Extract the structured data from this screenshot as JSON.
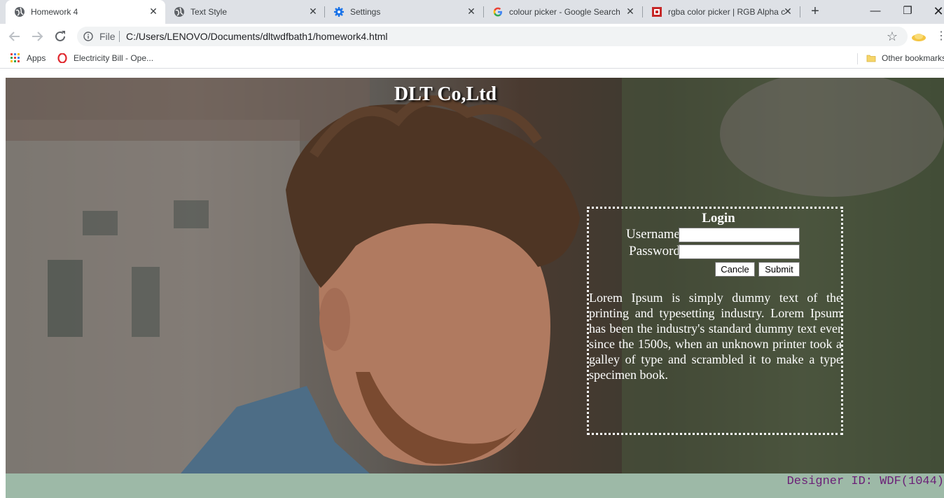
{
  "browser": {
    "tabs": [
      {
        "title": "Homework 4",
        "icon": "globe-icon",
        "active": true
      },
      {
        "title": "Text Style",
        "icon": "globe-icon",
        "active": false
      },
      {
        "title": "Settings",
        "icon": "gear-icon",
        "active": false
      },
      {
        "title": "colour picker - Google Search",
        "icon": "google-icon",
        "active": false
      },
      {
        "title": "rgba color picker | RGB Alpha c",
        "icon": "site-icon",
        "active": false
      }
    ],
    "address": {
      "scheme_label": "File",
      "url": "C:/Users/LENOVO/Documents/dltwdfbath1/homework4.html"
    },
    "bookmarks": {
      "apps_label": "Apps",
      "items": [
        {
          "label": "Electricity Bill - Ope...",
          "icon": "opera-icon"
        }
      ],
      "other_label": "Other bookmarks"
    }
  },
  "page": {
    "title": "DLT Co,Ltd",
    "login": {
      "heading": "Login",
      "username_label": "Username",
      "password_label": "Password",
      "cancel_label": "Cancle",
      "submit_label": "Submit"
    },
    "lorem": "Lorem Ipsum is simply dummy text of the printing and typesetting industry. Lorem Ipsum has been the industry's standard dummy text ever since the 1500s, when an unknown printer took a galley of type and scrambled it to make a type specimen book.",
    "designer_id": "Designer ID: WDF(1044)"
  },
  "colors": {
    "footer_bg": "#9db9a7",
    "designer_text": "#6b2077",
    "tabbar_bg": "#dee1e6"
  }
}
